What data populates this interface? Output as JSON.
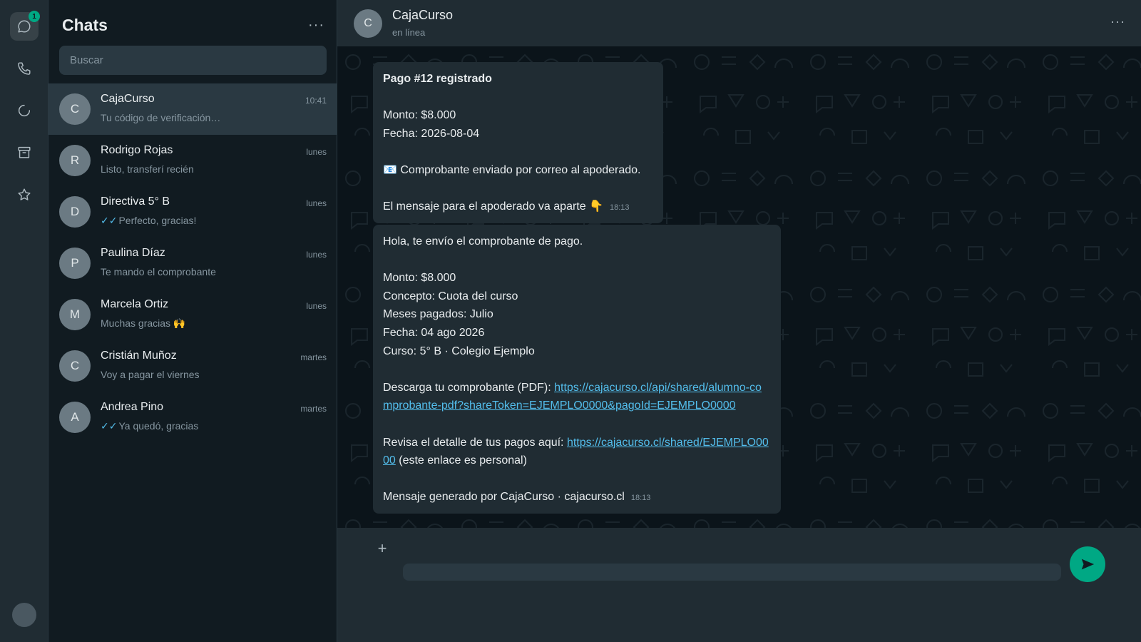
{
  "rail": {
    "chats_badge": "1",
    "icons": [
      "chats-icon",
      "calls-icon",
      "status-icon",
      "archive-icon",
      "starred-icon"
    ]
  },
  "sidebar": {
    "title": "Chats",
    "menu_label": "···",
    "search_placeholder": "Buscar",
    "chats": [
      {
        "initial": "C",
        "name": "CajaCurso",
        "time": "10:41",
        "preview": "Tu código de verificación…",
        "ticks": "",
        "selected": true
      },
      {
        "initial": "R",
        "name": "Rodrigo Rojas",
        "time": "lunes",
        "preview": "Listo, transferí recién",
        "ticks": ""
      },
      {
        "initial": "D",
        "name": "Directiva 5° B",
        "time": "lunes",
        "preview": "Perfecto, gracias!",
        "ticks": "✓✓"
      },
      {
        "initial": "P",
        "name": "Paulina Díaz",
        "time": "lunes",
        "preview": "Te mando el comprobante",
        "ticks": ""
      },
      {
        "initial": "M",
        "name": "Marcela Ortiz",
        "time": "lunes",
        "preview": "Muchas gracias 🙌",
        "ticks": ""
      },
      {
        "initial": "C",
        "name": "Cristián Muñoz",
        "time": "martes",
        "preview": "Voy a pagar el viernes",
        "ticks": ""
      },
      {
        "initial": "A",
        "name": "Andrea Pino",
        "time": "martes",
        "preview": "Ya quedó, gracias",
        "ticks": "✓✓"
      }
    ]
  },
  "conversation": {
    "avatar_initial": "C",
    "name": "CajaCurso",
    "status": "en línea",
    "menu_label": "···",
    "messages": [
      {
        "time": "18:13",
        "title": "Pago #12 registrado",
        "lines": [
          "Monto: $8.000",
          "Fecha: 2026-08-04",
          "📧 Comprobante enviado por correo al apoderado.",
          "El mensaje para el apoderado va aparte 👇"
        ]
      },
      {
        "time": "18:13",
        "intro": "Hola, te envío el comprobante de pago.",
        "details": [
          "Monto: $8.000",
          "Concepto: Cuota del curso",
          "Meses pagados: Julio",
          "Fecha: 04 ago 2026",
          "Curso: 5° B · Colegio Ejemplo"
        ],
        "pdf_label": "Descarga tu comprobante (PDF): ",
        "pdf_link": "https://cajacurso.cl/api/shared/alumno-comprobante-pdf?shareToken=EJEMPLO0000&pagoId=EJEMPLO0000",
        "detail_label": "Revisa el detalle de tus pagos aquí: ",
        "detail_link": "https://cajacurso.cl/shared/EJEMPLO0000",
        "detail_suffix": " (este enlace es personal)",
        "footer": "Mensaje generado por CajaCurso · cajacurso.cl"
      }
    ]
  },
  "composer": {
    "plus_label": "+",
    "input_placeholder": "",
    "send_icon": "send-icon"
  },
  "colors": {
    "accent": "#00a884",
    "link": "#53bdeb",
    "panel": "#202c33",
    "background": "#111b21"
  }
}
